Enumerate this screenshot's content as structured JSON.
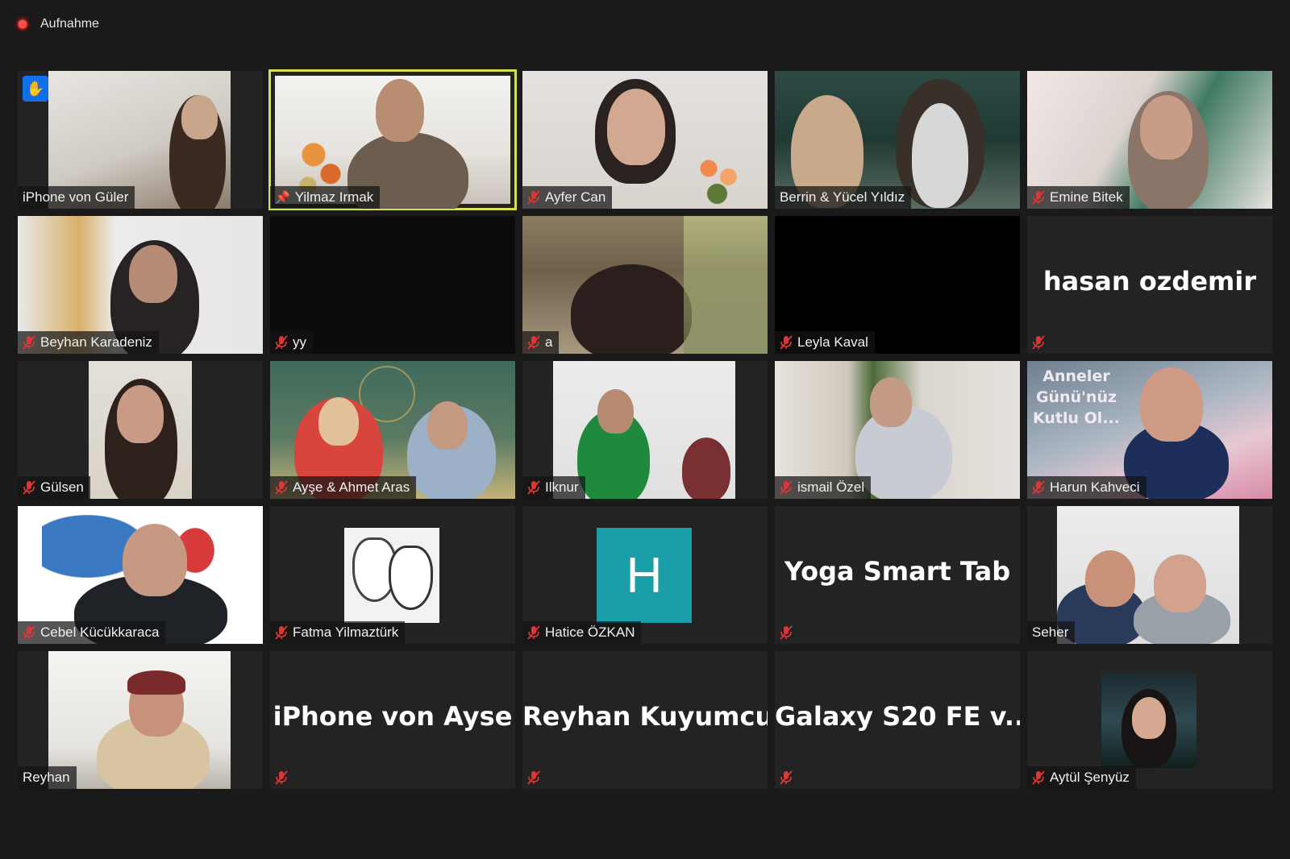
{
  "recording": {
    "label": "Aufnahme"
  },
  "colors": {
    "active_speaker": "#d4e157",
    "mic_off": "#e03535",
    "hand_raise": "#0e71eb"
  },
  "participants": [
    {
      "name": "iPhone von Güler",
      "muted": false,
      "hand_raised": true
    },
    {
      "name": "Yilmaz Irmak",
      "muted": false,
      "pinned": true,
      "active": true
    },
    {
      "name": "Ayfer Can",
      "muted": true
    },
    {
      "name": "Berrin & Yücel Yıldız",
      "muted": false
    },
    {
      "name": "Emine Bitek",
      "muted": true
    },
    {
      "name": "Beyhan Karadeniz",
      "muted": true
    },
    {
      "name": "yy",
      "muted": true
    },
    {
      "name": "a",
      "muted": true
    },
    {
      "name": "Leyla Kaval",
      "muted": true
    },
    {
      "name": "hasan ozdemir",
      "muted": true,
      "video_off": true
    },
    {
      "name": "Gülsen",
      "muted": true
    },
    {
      "name": "Ayşe & Ahmet  Aras",
      "muted": true
    },
    {
      "name": "Ilknur",
      "muted": true
    },
    {
      "name": "ismail Özel",
      "muted": true
    },
    {
      "name": "Harun Kahveci",
      "muted": true,
      "overlay_text": [
        "Anneler",
        "Günü'nüz",
        "Kutlu Ol..."
      ]
    },
    {
      "name": "Cebel Kücükkaraca",
      "muted": true
    },
    {
      "name": "Fatma Yilmaztürk",
      "muted": true
    },
    {
      "name": "Hatice ÖZKAN",
      "muted": true,
      "avatar_letter": "H"
    },
    {
      "name": "Yoga Smart Tab",
      "muted": true,
      "video_off": true
    },
    {
      "name": "Seher",
      "muted": false
    },
    {
      "name": "Reyhan",
      "muted": false
    },
    {
      "name": "iPhone von Ayse",
      "muted": true,
      "video_off": true
    },
    {
      "name": "Reyhan Kuyumcu",
      "muted": true,
      "video_off": true
    },
    {
      "name": "Galaxy S20 FE v...",
      "muted": true,
      "video_off": true
    },
    {
      "name": "Aytül Şenyüz",
      "muted": true
    }
  ]
}
